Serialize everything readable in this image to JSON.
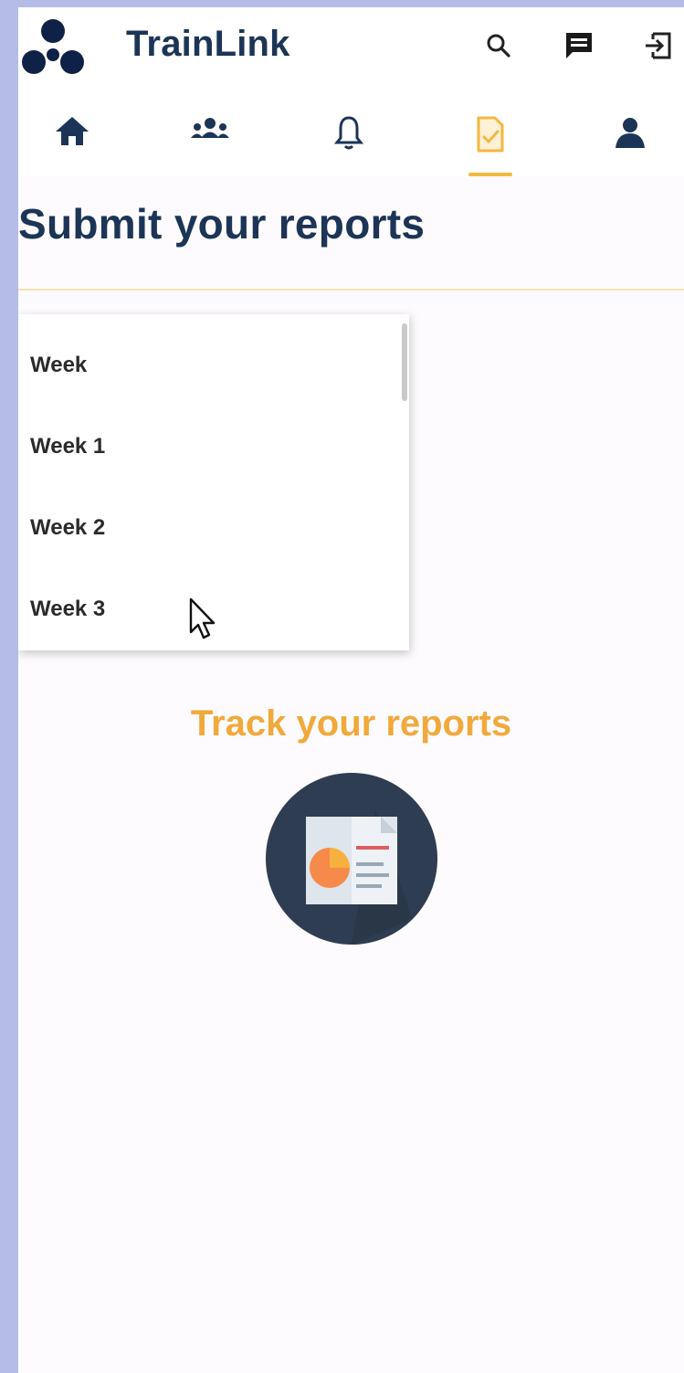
{
  "app": {
    "title": "TrainLink"
  },
  "header_icons": [
    "search-icon",
    "chat-icon",
    "logout-icon"
  ],
  "tabs": [
    {
      "name": "home",
      "icon": "home-icon",
      "active": false
    },
    {
      "name": "groups",
      "icon": "groups-icon",
      "active": false
    },
    {
      "name": "notifications",
      "icon": "bell-icon",
      "active": false
    },
    {
      "name": "reports",
      "icon": "report-check-icon",
      "active": true
    },
    {
      "name": "profile",
      "icon": "person-icon",
      "active": false
    }
  ],
  "page": {
    "title": "Submit your reports"
  },
  "week_dropdown": {
    "options": [
      "Week",
      "Week 1",
      "Week 2",
      "Week 3"
    ]
  },
  "track": {
    "title": "Track your reports",
    "icon": "report-chart-icon"
  },
  "colors": {
    "navy": "#1c3557",
    "accent": "#f3b83f",
    "track_title": "#f2a93b",
    "background": "#fdfbfe",
    "frame": "#b5bde6"
  }
}
